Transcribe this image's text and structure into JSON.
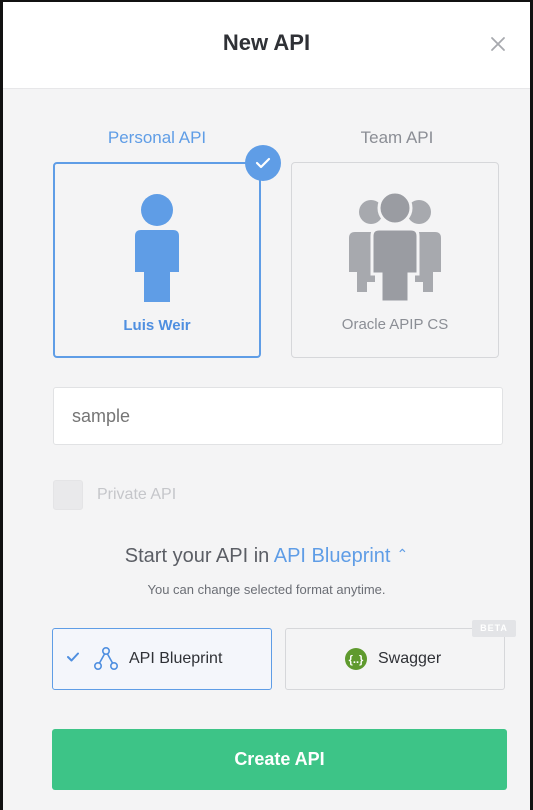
{
  "modal": {
    "title": "New API",
    "close_icon": "close-icon"
  },
  "owner": {
    "personal_label": "Personal API",
    "team_label": "Team API",
    "personal_name": "Luis Weir",
    "team_name": "Oracle APIP CS",
    "selected": "personal"
  },
  "api_name": {
    "value": "",
    "placeholder": "sample"
  },
  "private": {
    "label": "Private API",
    "checked": false
  },
  "format": {
    "heading_prefix": "Start your API in",
    "heading_link": "API Blueprint",
    "note": "You can change selected format anytime.",
    "options": [
      {
        "label": "API Blueprint",
        "icon": "api-blueprint-icon",
        "selected": true
      },
      {
        "label": "Swagger",
        "icon": "swagger-icon",
        "selected": false,
        "badge": "BETA"
      }
    ]
  },
  "create_button": "Create API",
  "colors": {
    "accent": "#5f9de6",
    "create": "#3dc487",
    "swagger": "#5f9a2e"
  }
}
